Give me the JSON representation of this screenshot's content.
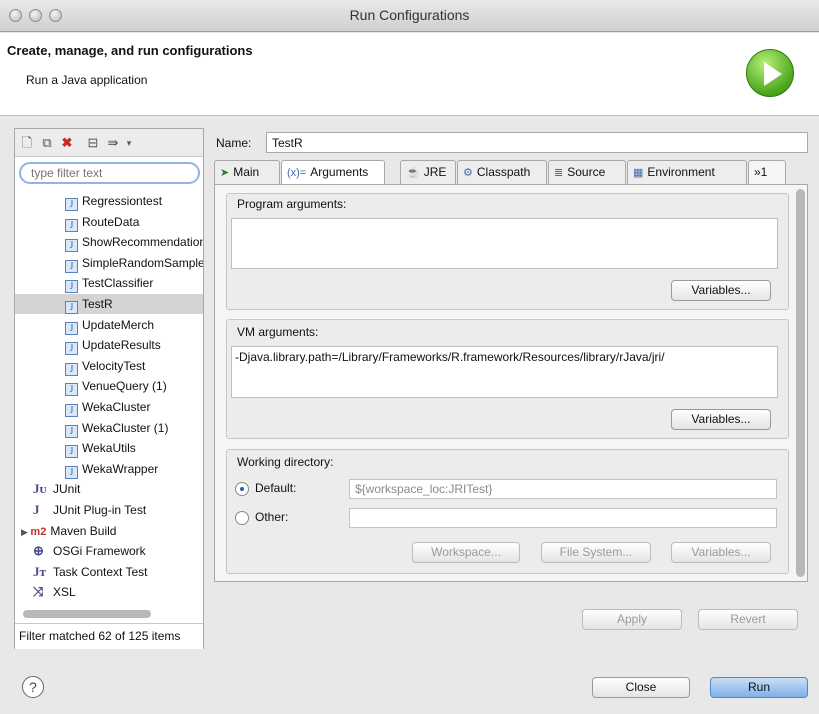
{
  "window": {
    "title": "Run Configurations"
  },
  "header": {
    "title": "Create, manage, and run configurations",
    "subtitle": "Run a Java application"
  },
  "filter": {
    "placeholder": "type filter text",
    "status": "Filter matched 62 of 125 items"
  },
  "tree": {
    "items": [
      {
        "label": "Regressiontest",
        "kind": "java"
      },
      {
        "label": "RouteData",
        "kind": "java"
      },
      {
        "label": "ShowRecommendations",
        "kind": "java"
      },
      {
        "label": "SimpleRandomSampler",
        "kind": "java"
      },
      {
        "label": "TestClassifier",
        "kind": "java"
      },
      {
        "label": "TestR",
        "kind": "java",
        "selected": true
      },
      {
        "label": "UpdateMerch",
        "kind": "java"
      },
      {
        "label": "UpdateResults",
        "kind": "java"
      },
      {
        "label": "VelocityTest",
        "kind": "java"
      },
      {
        "label": "VenueQuery (1)",
        "kind": "java"
      },
      {
        "label": "WekaCluster",
        "kind": "java"
      },
      {
        "label": "WekaCluster (1)",
        "kind": "java"
      },
      {
        "label": "WekaUtils",
        "kind": "java"
      },
      {
        "label": "WekaWrapper",
        "kind": "java"
      }
    ],
    "categories": [
      {
        "label": "JUnit",
        "icon": "Jᴜ"
      },
      {
        "label": "JUnit Plug-in Test",
        "icon": "J"
      },
      {
        "label": "Maven Build",
        "icon": "m2"
      },
      {
        "label": "OSGi Framework",
        "icon": "⊕"
      },
      {
        "label": "Task Context Test",
        "icon": "Jᴛ"
      },
      {
        "label": "XSL",
        "icon": "⤨"
      }
    ]
  },
  "config": {
    "name_label": "Name:",
    "name_value": "TestR",
    "tabs": [
      "Main",
      "Arguments",
      "JRE",
      "Classpath",
      "Source",
      "Environment",
      "»1"
    ],
    "program_args_label": "Program arguments:",
    "program_args_value": "",
    "vm_args_label": "VM arguments:",
    "vm_args_value": "-Djava.library.path=/Library/Frameworks/R.framework/Resources/library/rJava/jri/",
    "variables_label": "Variables...",
    "working_dir_label": "Working directory:",
    "default_label": "Default:",
    "default_value": "${workspace_loc:JRITest}",
    "other_label": "Other:",
    "other_value": "",
    "workspace_btn": "Workspace...",
    "filesystem_btn": "File System...",
    "apply_btn": "Apply",
    "revert_btn": "Revert"
  },
  "footer": {
    "help": "?",
    "close": "Close",
    "run": "Run"
  },
  "colors": {
    "accent": "#7fb0ea",
    "run_green": "#4ca51c",
    "selection": "#d4d4d4"
  }
}
